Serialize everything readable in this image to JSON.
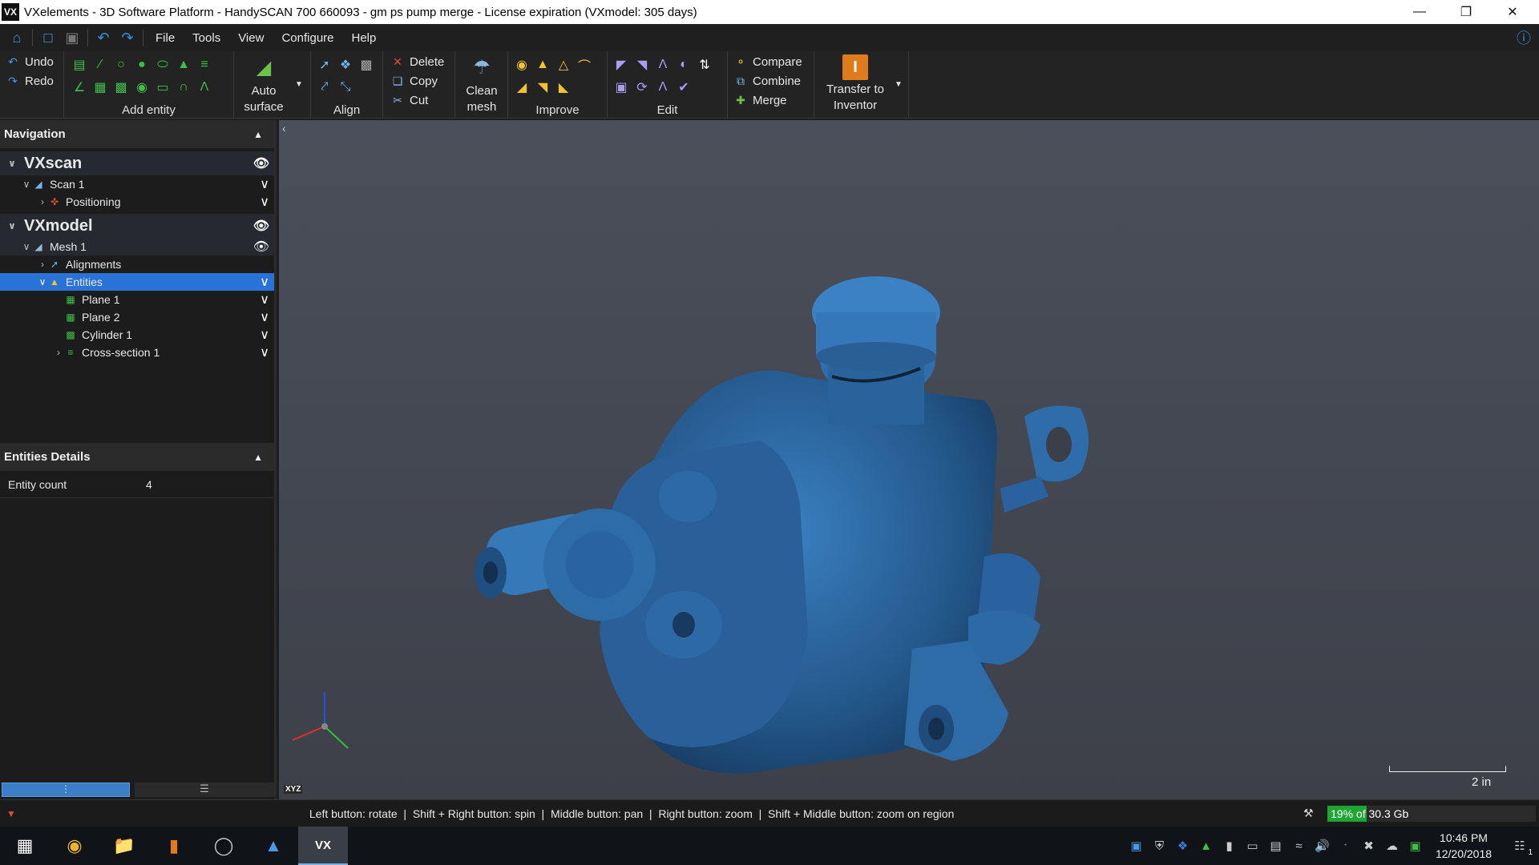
{
  "window": {
    "title": "VXelements - 3D Software Platform - HandySCAN 700 660093 - gm ps pump merge - License expiration (VXmodel: 305 days)",
    "app_icon": "VX"
  },
  "menu": {
    "items": [
      "File",
      "Tools",
      "View",
      "Configure",
      "Help"
    ]
  },
  "ribbon": {
    "undo": "Undo",
    "redo": "Redo",
    "add_entity": "Add entity",
    "auto_surface_line1": "Auto",
    "auto_surface_line2": "surface",
    "align": "Align",
    "delete": "Delete",
    "copy": "Copy",
    "cut": "Cut",
    "clean_mesh_line1": "Clean",
    "clean_mesh_line2": "mesh",
    "improve": "Improve",
    "edit": "Edit",
    "compare": "Compare",
    "combine": "Combine",
    "merge": "Merge",
    "transfer_line1": "Transfer to",
    "transfer_line2": "Inventor"
  },
  "navigation": {
    "title": "Navigation",
    "vxscan": "VXscan",
    "scan1": "Scan 1",
    "positioning": "Positioning",
    "vxmodel": "VXmodel",
    "mesh1": "Mesh 1",
    "alignments": "Alignments",
    "entities": "Entities",
    "plane1": "Plane 1",
    "plane2": "Plane 2",
    "cylinder1": "Cylinder 1",
    "cross_section1": "Cross-section 1"
  },
  "details": {
    "title": "Entities Details",
    "entity_count_label": "Entity count",
    "entity_count_value": "4"
  },
  "viewport": {
    "scale_label": "2 in",
    "axis_label": "XYZ",
    "model_color": "#2d6aa3"
  },
  "status": {
    "hint": "Left button: rotate  |  Shift + Right button: spin  |  Middle button: pan  |  Right button: zoom  |  Shift + Middle button: zoom on region",
    "memory": "19% of 30.3 Gb",
    "memory_fraction": 0.19
  },
  "taskbar": {
    "time": "10:46 PM",
    "date": "12/20/2018",
    "notification_count": "1"
  }
}
